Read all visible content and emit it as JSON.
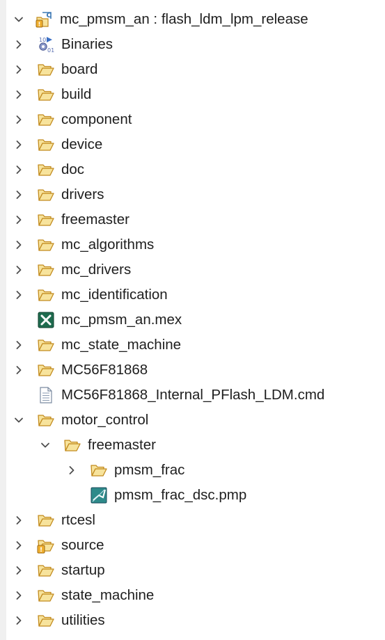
{
  "tree": {
    "root": {
      "label": "mc_pmsm_an : flash_ldm_lpm_release",
      "icon": "project-icon",
      "expanded": true
    },
    "items": [
      {
        "label": "Binaries",
        "icon": "binaries-icon",
        "expandable": true
      },
      {
        "label": "board",
        "icon": "folder-icon",
        "expandable": true
      },
      {
        "label": "build",
        "icon": "folder-icon",
        "expandable": true
      },
      {
        "label": "component",
        "icon": "folder-icon",
        "expandable": true
      },
      {
        "label": "device",
        "icon": "folder-icon",
        "expandable": true
      },
      {
        "label": "doc",
        "icon": "folder-icon",
        "expandable": true
      },
      {
        "label": "drivers",
        "icon": "folder-icon",
        "expandable": true
      },
      {
        "label": "freemaster",
        "icon": "folder-icon",
        "expandable": true
      },
      {
        "label": "mc_algorithms",
        "icon": "folder-icon",
        "expandable": true
      },
      {
        "label": "mc_drivers",
        "icon": "folder-icon",
        "expandable": true
      },
      {
        "label": "mc_identification",
        "icon": "folder-icon",
        "expandable": true
      },
      {
        "label": "mc_pmsm_an.mex",
        "icon": "mex-file-icon",
        "expandable": false
      },
      {
        "label": "mc_state_machine",
        "icon": "folder-icon",
        "expandable": true
      },
      {
        "label": "MC56F81868",
        "icon": "folder-icon",
        "expandable": true
      },
      {
        "label": "MC56F81868_Internal_PFlash_LDM.cmd",
        "icon": "text-file-icon",
        "expandable": false
      },
      {
        "label": "motor_control",
        "icon": "folder-icon",
        "expandable": true,
        "expanded": true,
        "children": [
          {
            "label": "freemaster",
            "icon": "folder-icon",
            "expandable": true,
            "expanded": true,
            "children": [
              {
                "label": "pmsm_frac",
                "icon": "folder-icon",
                "expandable": true
              },
              {
                "label": "pmsm_frac_dsc.pmp",
                "icon": "pmp-file-icon",
                "expandable": false
              }
            ]
          }
        ]
      },
      {
        "label": "rtcesl",
        "icon": "folder-icon",
        "expandable": true
      },
      {
        "label": "source",
        "icon": "source-folder-icon",
        "expandable": true
      },
      {
        "label": "startup",
        "icon": "folder-icon",
        "expandable": true
      },
      {
        "label": "state_machine",
        "icon": "folder-icon",
        "expandable": true
      },
      {
        "label": "utilities",
        "icon": "folder-icon",
        "expandable": true
      }
    ]
  },
  "colors": {
    "folder_fill": "#f7e39c",
    "folder_stroke": "#c28a1e",
    "chevron": "#4d4d4d",
    "mex_icon_fill": "#1e6b4e",
    "pmp_icon_fill": "#2e8a8a",
    "project_icon_fill": "#3c78b4"
  }
}
